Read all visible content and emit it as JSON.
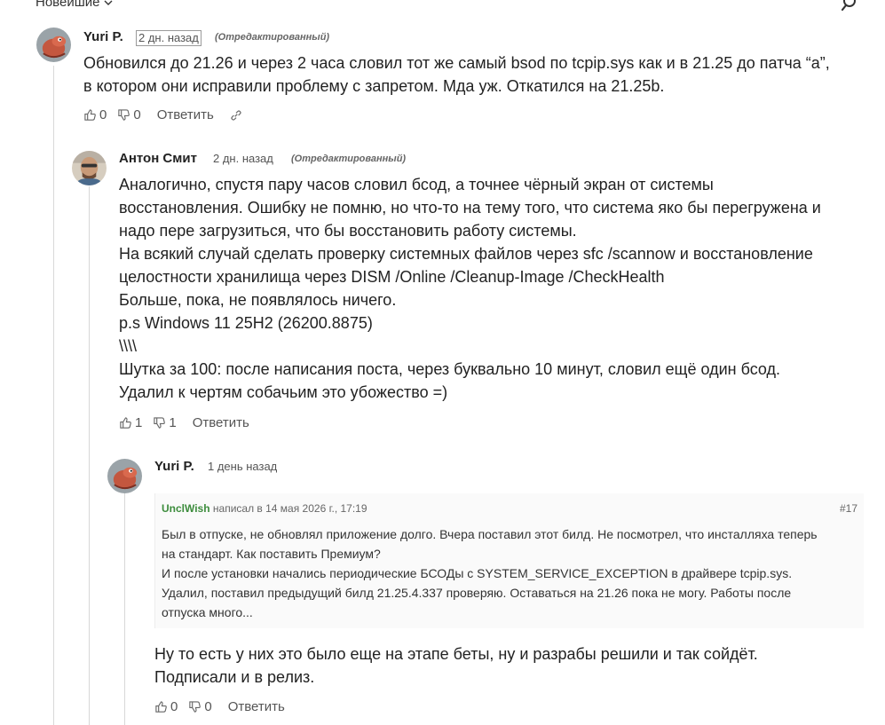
{
  "toolbar": {
    "sort_label": "Новейшие"
  },
  "comments": [
    {
      "author": "Yuri P.",
      "time": "2 дн. назад",
      "edited": "(Отредактированный)",
      "lines": [
        "Обновился до 21.26 и через 2 часа словил тот же самый bsod по tcpip.sys как и в 21.25 до патча “a”,",
        "в котором они исправили проблему с запретом. Мда уж. Откатился на 21.25b."
      ],
      "likes": "0",
      "dislikes": "0",
      "reply": "Ответить"
    },
    {
      "author": "Антон Смит",
      "time": "2 дн. назад",
      "edited": "(Отредактированный)",
      "lines": [
        "Аналогично, спустя пару часов словил бсод, а точнее чёрный экран от системы",
        "восстановления. Ошибку не помню, но что-то на тему того, что система яко бы перегружена и",
        "надо пере загрузиться, что бы восстановить работу системы.",
        "На всякий случай сделать проверку системных файлов через sfc /scannow и восстановление",
        "целостности хранилища через DISM /Online /Cleanup-Image /CheckHealth",
        "Больше, пока, не появлялось ничего.",
        "p.s Windows 11 25H2 (26200.8875)",
        "\\\\\\\\",
        "Шутка за 100: после написания поста, через буквально 10 минут, словил ещё один бсод.",
        "Удалил к чертям собачьим это убожество =)"
      ],
      "likes": "1",
      "dislikes": "1",
      "reply": "Ответить"
    },
    {
      "author": "Yuri P.",
      "time": "1 день назад",
      "quote": {
        "user": "UnclWish",
        "meta": " написал в 14 мая 2026 г., 17:19",
        "number": "#17",
        "lines": [
          "Был в отпуске, не обновлял приложение долго. Вчера поставил этот билд. Не посмотрел, что инсталляха теперь",
          "на стандарт. Как поставить Премиум?",
          "И после установки начались периодические БСОДы с SYSTEM_SERVICE_EXCEPTION в драйвере tcpip.sys.",
          "Удалил, поставил предыдущий билд 21.25.4.337 проверяю. Оставаться на 21.26 пока не могу. Работы после",
          "отпуска много..."
        ]
      },
      "lines": [
        "Ну то есть у них это было еще на этапе беты, ну и разрабы решили и так сойдёт.",
        "Подписали и в релиз."
      ],
      "likes": "0",
      "dislikes": "0",
      "reply": "Ответить"
    }
  ],
  "icons": {
    "search": "search-icon",
    "chevron": "chevron-down-icon",
    "like": "thumb-up-icon",
    "dislike": "thumb-down-icon",
    "link": "link-icon",
    "avatar_lizard": "lizard-avatar",
    "avatar_person": "person-photo-avatar"
  },
  "colors": {
    "quote_user": "#3c8c3c",
    "thread_line": "#d8d8d8",
    "muted_text": "#555555"
  }
}
